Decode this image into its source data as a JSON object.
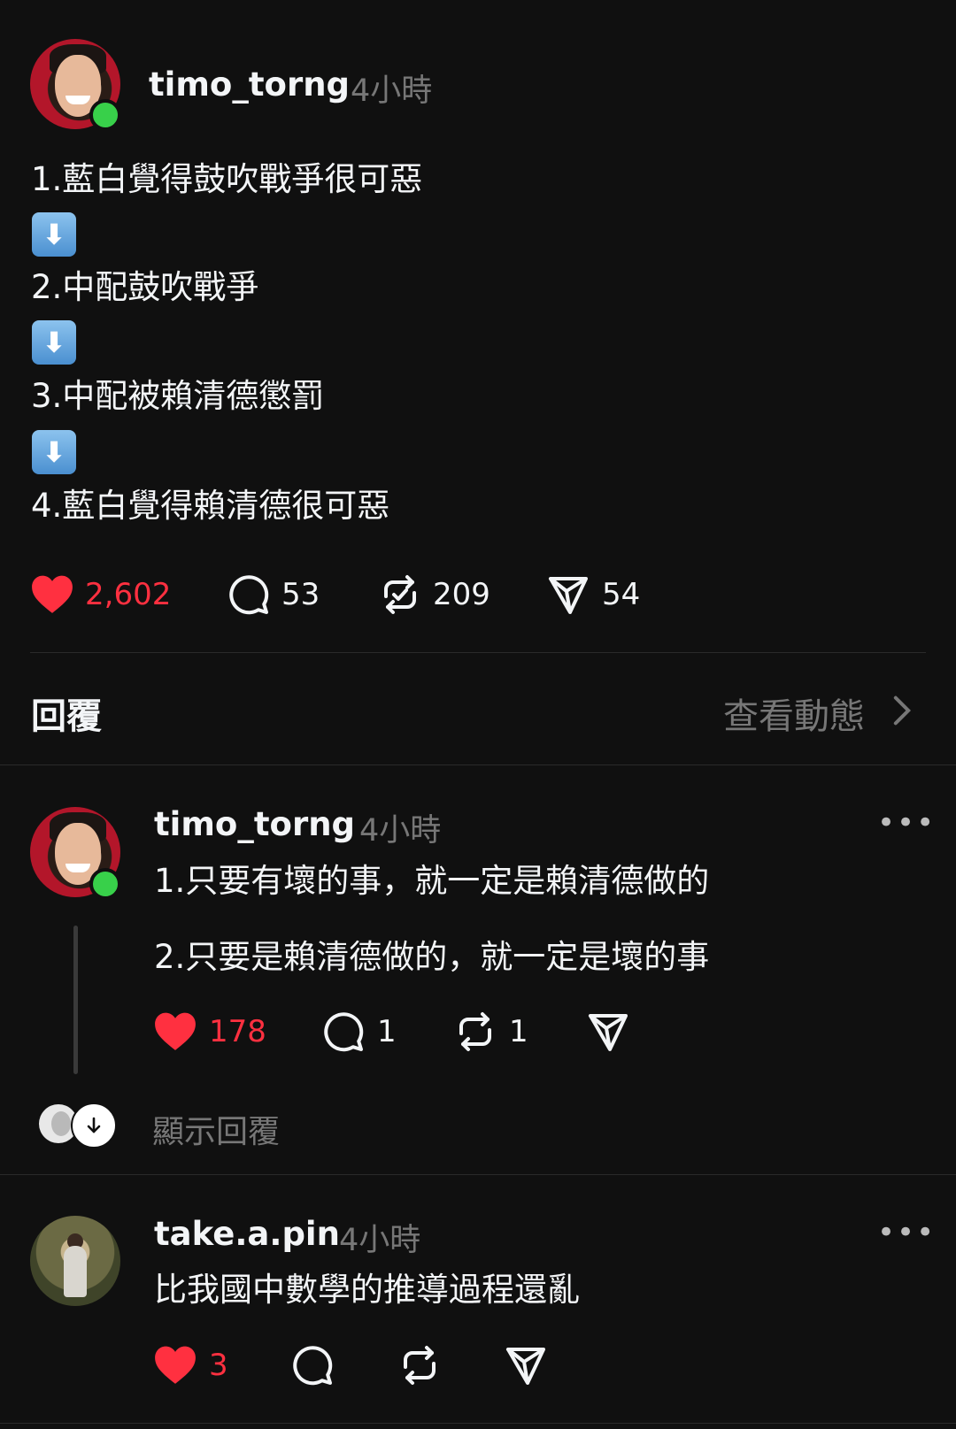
{
  "post": {
    "username": "timo_torng",
    "time": "4小時",
    "lines": [
      "1.藍白覺得鼓吹戰爭很可惡",
      "2.中配鼓吹戰爭",
      "3.中配被賴清德懲罰",
      "4.藍白覺得賴清德很可惡"
    ],
    "arrow_emoji": "⬇",
    "likes": "2,602",
    "comments": "53",
    "reposts": "209",
    "shares": "54"
  },
  "replies_header": {
    "title": "回覆",
    "view_activity": "查看動態"
  },
  "replies": [
    {
      "username": "timo_torng",
      "time": "4小時",
      "lines": [
        "1.只要有壞的事，就一定是賴清德做的",
        "2.只要是賴清德做的，就一定是壞的事"
      ],
      "likes": "178",
      "comments": "1",
      "reposts": "1",
      "show_replies": "顯示回覆"
    },
    {
      "username": "take.a.pin",
      "time": "4小時",
      "text": "比我國中數學的推導過程還亂",
      "likes": "3"
    }
  ],
  "colors": {
    "accent_like": "#ff3040",
    "background": "#101010",
    "online": "#38d04a"
  },
  "icons": [
    "heart-icon",
    "comment-icon",
    "repost-icon",
    "share-icon",
    "chevron-right-icon",
    "more-icon"
  ]
}
